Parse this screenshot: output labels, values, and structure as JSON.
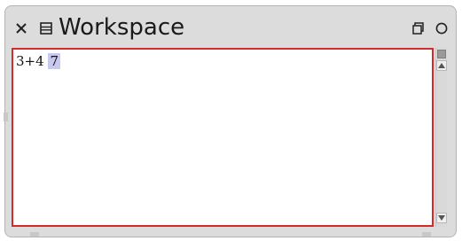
{
  "window": {
    "title": "Workspace",
    "icons": {
      "close": "close-icon",
      "menu": "window-menu-icon",
      "collapse": "collapse-icon",
      "expand": "expand-icon"
    }
  },
  "editor": {
    "expression": "3+4 ",
    "result": "7"
  },
  "colors": {
    "pane_border": "#d22b2b",
    "selection": "#c7c9f0",
    "window_bg": "#dcdcdc"
  }
}
